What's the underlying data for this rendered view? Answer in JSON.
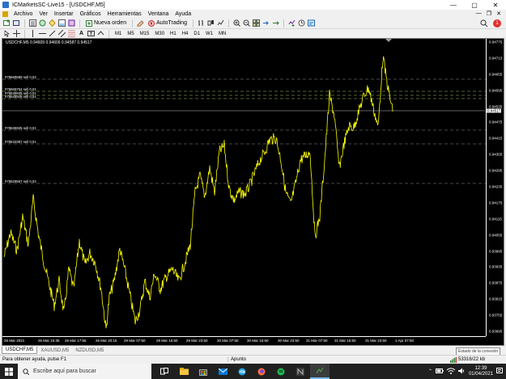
{
  "window": {
    "title": "ICMarketsSC-Live15 - [USDCHF,M5]",
    "minimize": "—",
    "maximize": "▢",
    "close": "✕"
  },
  "menu": {
    "items": [
      "Archivo",
      "Ver",
      "Insertar",
      "Gráficos",
      "Herramientas",
      "Ventana",
      "Ayuda"
    ],
    "mdi_minimize": "—",
    "mdi_restore": "❐",
    "mdi_close": "✕"
  },
  "toolbar": {
    "new_order": "Nueva orden",
    "autotrading": "AutoTrading",
    "alert_count": "1"
  },
  "timeframes": [
    "M1",
    "M5",
    "M15",
    "M30",
    "H1",
    "H4",
    "D1",
    "W1",
    "MN"
  ],
  "chart": {
    "header": "USDCHF,M5  0.94609 0.94609 0.94587 0.94517",
    "current_price_label": "0.94517",
    "y_ticks": [
      "0.94775",
      "0.94713",
      "0.94655",
      "0.94595",
      "0.94535",
      "0.94475",
      "0.94415",
      "0.94355",
      "0.94295",
      "0.94235",
      "0.94175",
      "0.94115",
      "0.94055",
      "0.93995",
      "0.93935",
      "0.93875",
      "0.93815",
      "0.93755",
      "0.93695"
    ],
    "x_ticks": [
      "26 Mar 2021",
      "26 Mar 15:35",
      "26 Mar 17:55",
      "26 Mar 20:15",
      "29 Mar 07:50",
      "29 Mar 15:50",
      "29 Mar 23:50",
      "30 Mar 07:50",
      "30 Mar 15:50",
      "30 Mar 23:50",
      "31 Mar 07:50",
      "31 Mar 15:50",
      "31 Mar 23:50",
      "1 Apr 07:50"
    ],
    "orders": [
      {
        "label": "#78669589 sell 0.02",
        "color": "#8f8f8f"
      },
      {
        "label": "#78669754 sell 0.01",
        "color": "#8f8f8f"
      },
      {
        "label": "#78639935 sell 0.01",
        "color": "#8f8f8f"
      },
      {
        "label": "#78628926 sell 0.01",
        "color": "#8f8f8f"
      },
      {
        "label": "#78636925 sell 0.01",
        "color": "#8f8f8f"
      },
      {
        "label": "#78633387 sell 0.01",
        "color": "#8f8f8f"
      },
      {
        "label": "#78629567 sell 0.02",
        "color": "#8f8f8f"
      }
    ],
    "line_color": "#ffff00",
    "background": "#000000"
  },
  "tabs": [
    "USDCHF,M5",
    "XAUUSD,M5",
    "NZDUSD,M5"
  ],
  "status": {
    "help": "Para obtener ayuda, pulse F1",
    "profile": "Apunto",
    "connection": "53316/22 kb",
    "tooltip": "Estado de la conexión"
  },
  "taskbar": {
    "search_placeholder": "Escribe aquí para buscar",
    "time": "12:39",
    "date": "01/04/2021"
  }
}
